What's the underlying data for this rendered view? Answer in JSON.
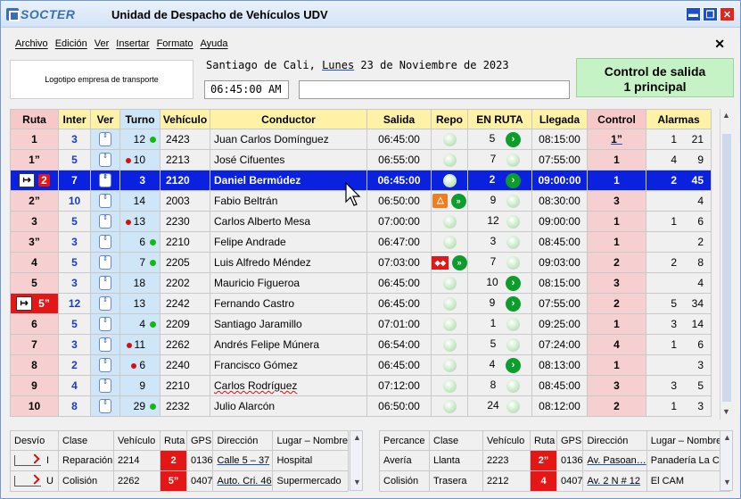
{
  "window": {
    "brand": "SOCTER",
    "title": "Unidad de Despacho de Vehículos UDV",
    "buttons": {
      "minimize": "▬",
      "restore": "❐",
      "close": "✕"
    }
  },
  "menu": [
    "Archivo",
    "Edición",
    "Ver",
    "Insertar",
    "Formato",
    "Ayuda"
  ],
  "menu_close": "✕",
  "logo_placeholder": "Logotipo empresa de transporte",
  "date": {
    "city": "Santiago de Cali,",
    "weekday": "Lunes",
    "rest": "23 de Noviembre de 2023"
  },
  "time": "06:45:00 AM",
  "note": "",
  "control_box": {
    "line1": "Control de salida",
    "line2": "1 principal"
  },
  "main_table": {
    "headers": [
      "Ruta",
      "Inter",
      "Ver",
      "Turno",
      "Vehículo",
      "Conductor",
      "Salida",
      "Repo",
      "EN RUTA",
      "Llegada",
      "Control",
      "Alarmas"
    ],
    "rows": [
      {
        "ruta": "1",
        "inter": "3",
        "turno": "12",
        "turno_dot": "green",
        "veh": "2423",
        "cond": "Juan Carlos Domínguez",
        "salida": "06:45:00",
        "repo": "ball",
        "enruta": "5",
        "enruta_icon": "go",
        "llegada": "08:15:00",
        "control": "1”",
        "alarm1": "1",
        "alarm2": "21"
      },
      {
        "ruta": "1”",
        "inter": "5",
        "turno": "10",
        "turno_dot": "red",
        "veh": "2213",
        "cond": "José Cifuentes",
        "salida": "06:55:00",
        "repo": "ball",
        "enruta": "7",
        "enruta_icon": "ball",
        "llegada": "07:55:00",
        "control": "1",
        "alarm1": "4",
        "alarm2": "9"
      },
      {
        "ruta": "2",
        "ruta_flag": true,
        "inter": "7",
        "turno": "3",
        "turno_dot": "",
        "veh": "2120",
        "cond": "Daniel Bermúdez",
        "salida": "06:45:00",
        "repo": "ball",
        "enruta": "2",
        "enruta_icon": "go",
        "llegada": "09:00:00",
        "control": "1",
        "alarm1": "2",
        "alarm2": "45",
        "selected": true
      },
      {
        "ruta": "2”",
        "inter": "10",
        "turno": "14",
        "turno_dot": "",
        "veh": "2003",
        "cond": "Fabio Beltrán",
        "salida": "06:50:00",
        "repo": "warn",
        "enruta": "9",
        "enruta_icon": "ball",
        "llegada": "08:30:00",
        "control": "3",
        "alarm1": "",
        "alarm2": "4"
      },
      {
        "ruta": "3",
        "inter": "5",
        "turno": "13",
        "turno_dot": "red",
        "veh": "2230",
        "cond": "Carlos Alberto Mesa",
        "salida": "07:00:00",
        "repo": "ball",
        "enruta": "12",
        "enruta_icon": "ball",
        "llegada": "09:00:00",
        "control": "1",
        "alarm1": "1",
        "alarm2": "6"
      },
      {
        "ruta": "3”",
        "inter": "3",
        "turno": "6",
        "turno_dot": "green",
        "veh": "2210",
        "cond": "Felipe Andrade",
        "salida": "06:47:00",
        "repo": "ball",
        "enruta": "3",
        "enruta_icon": "ball",
        "llegada": "08:45:00",
        "control": "1",
        "alarm1": "",
        "alarm2": "2"
      },
      {
        "ruta": "4",
        "inter": "5",
        "turno": "7",
        "turno_dot": "green",
        "veh": "2205",
        "cond": "Luis Alfredo Méndez",
        "salida": "07:03:00",
        "repo": "swap",
        "enruta": "7",
        "enruta_icon": "ball",
        "llegada": "09:03:00",
        "control": "2",
        "alarm1": "2",
        "alarm2": "8"
      },
      {
        "ruta": "5",
        "inter": "3",
        "turno": "18",
        "turno_dot": "",
        "veh": "2202",
        "cond": "Mauricio Figueroa",
        "salida": "06:45:00",
        "repo": "ball",
        "enruta": "10",
        "enruta_icon": "go",
        "llegada": "08:15:00",
        "control": "3",
        "alarm1": "",
        "alarm2": "4"
      },
      {
        "ruta": "5”",
        "ruta_flag": true,
        "inter": "12",
        "turno": "13",
        "turno_dot": "",
        "veh": "2242",
        "cond": "Fernando Castro",
        "salida": "06:45:00",
        "repo": "ball",
        "enruta": "9",
        "enruta_icon": "go",
        "llegada": "07:55:00",
        "control": "2",
        "alarm1": "5",
        "alarm2": "34"
      },
      {
        "ruta": "6",
        "inter": "5",
        "turno": "4",
        "turno_dot": "green",
        "veh": "2209",
        "cond": "Santiago Jaramillo",
        "salida": "07:01:00",
        "repo": "ball",
        "enruta": "1",
        "enruta_icon": "ball",
        "llegada": "09:25:00",
        "control": "1",
        "alarm1": "3",
        "alarm2": "14"
      },
      {
        "ruta": "7",
        "inter": "3",
        "turno": "11",
        "turno_dot": "red",
        "veh": "2262",
        "cond": "Andrés Felipe Múnera",
        "salida": "06:54:00",
        "repo": "ball",
        "enruta": "5",
        "enruta_icon": "ball",
        "llegada": "07:24:00",
        "control": "4",
        "alarm1": "1",
        "alarm2": "6"
      },
      {
        "ruta": "8",
        "inter": "2",
        "turno": "6",
        "turno_dot": "red",
        "veh": "2240",
        "cond": "Francisco Gómez",
        "salida": "06:45:00",
        "repo": "ball",
        "enruta": "4",
        "enruta_icon": "go",
        "llegada": "08:13:00",
        "control": "1",
        "alarm1": "",
        "alarm2": "3"
      },
      {
        "ruta": "9",
        "inter": "4",
        "turno": "9",
        "turno_dot": "",
        "veh": "2210",
        "cond": "Carlos Rodríguez",
        "salida": "07:12:00",
        "repo": "ball",
        "enruta": "8",
        "enruta_icon": "ball",
        "llegada": "08:45:00",
        "control": "3",
        "alarm1": "3",
        "alarm2": "5"
      },
      {
        "ruta": "10",
        "inter": "8",
        "turno": "29",
        "turno_dot": "green",
        "veh": "2232",
        "cond": "Julio Alarcón",
        "salida": "06:50:00",
        "repo": "ball",
        "enruta": "24",
        "enruta_icon": "ball",
        "llegada": "08:12:00",
        "control": "2",
        "alarm1": "1",
        "alarm2": "3"
      }
    ]
  },
  "desvio_table": {
    "headers": [
      "Desvío",
      "Clase",
      "Vehículo",
      "Ruta",
      "GPS",
      "Dirección",
      "Lugar – Nombre"
    ],
    "rows": [
      {
        "tipo": "I",
        "clase": "Reparación",
        "veh": "2214",
        "ruta": "2",
        "gps": "0136",
        "dir": "Calle 5 – 37",
        "lugar": "Hospital"
      },
      {
        "tipo": "U",
        "clase": "Colisión",
        "veh": "2262",
        "ruta": "5”",
        "gps": "0407",
        "dir": "Auto. Cri. 46",
        "lugar": "Supermercado"
      }
    ]
  },
  "percance_table": {
    "headers": [
      "Percance",
      "Clase",
      "Vehículo",
      "Ruta",
      "GPS",
      "Dirección",
      "Lugar – Nombre"
    ],
    "rows": [
      {
        "percance": "Avería",
        "clase": "Llanta",
        "veh": "2223",
        "ruta": "2”",
        "gps": "0136",
        "dir": "Av. Pasoan…",
        "lugar": "Panadería La C…"
      },
      {
        "percance": "Colisión",
        "clase": "Trasera",
        "veh": "2212",
        "ruta": "4",
        "gps": "0407",
        "dir": "Av. 2 N # 12",
        "lugar": "El CAM"
      }
    ]
  },
  "icons": {
    "up_down": "⇕",
    "go_arrow": "›",
    "warn": "△",
    "ffwd": "»",
    "swap": "◆◆",
    "exit": "↦"
  },
  "colors": {
    "selected_row": "#0b21e0",
    "ruta_pink": "#f6d0d0",
    "header_yellow": "#fff2a6",
    "control_green": "#c6f3c6",
    "flag_red": "#e41616"
  }
}
